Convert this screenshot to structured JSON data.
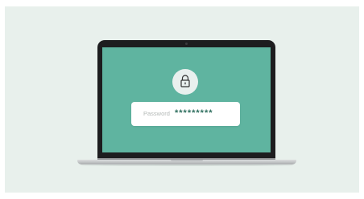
{
  "login": {
    "password_label": "Password",
    "password_mask": "*********"
  },
  "icons": {
    "lock": "lock-icon"
  },
  "colors": {
    "background": "#e8f0ec",
    "screen": "#5fb4a0",
    "bezel": "#1d1d1f",
    "mask_text": "#2f6f5f"
  }
}
